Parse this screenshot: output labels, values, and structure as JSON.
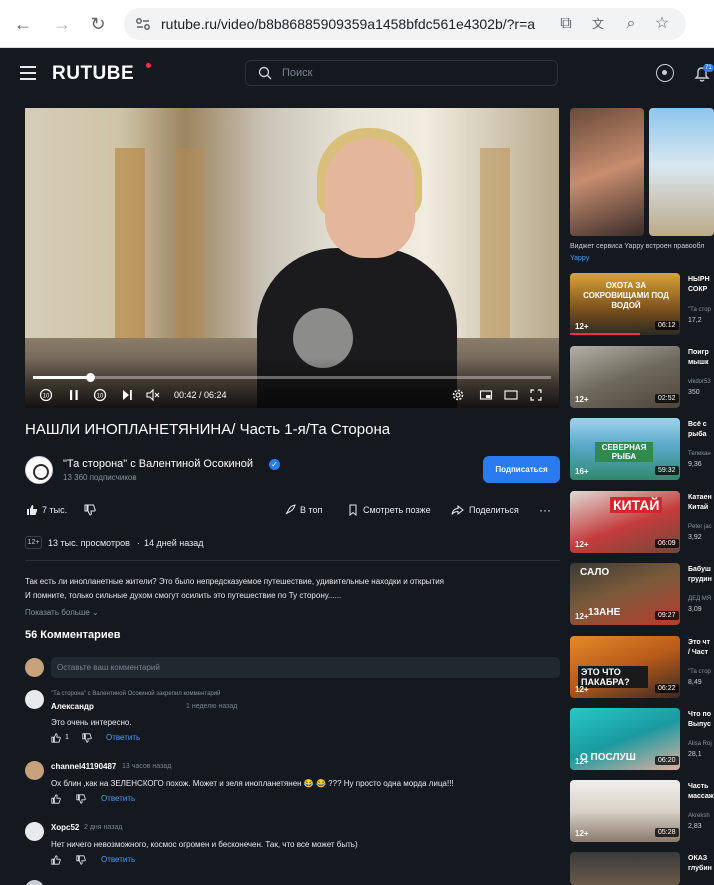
{
  "browser": {
    "url": "rutube.ru/video/b8b86885909359a1458bfdc561e4302b/?r=a"
  },
  "header": {
    "logo": "RUTUBE",
    "search_placeholder": "Поиск",
    "notifications_count": "71"
  },
  "player": {
    "time": "00:42 / 06:24",
    "progress": 0.11,
    "rewind_label": "10",
    "forward_label": "10"
  },
  "video": {
    "title": "НАШЛИ ИНОПЛАНЕТЯНИНА/ Часть 1-я/Та Сторона",
    "channel_name": "\"Та сторона\" с Валентиной Осокиной",
    "subscribers": "13 360 подписчиков",
    "subscribe_label": "Подписаться",
    "likes": "7 тыс.",
    "top_label": "В топ",
    "watch_later_label": "Смотреть позже",
    "share_label": "Поделиться",
    "age": "12+",
    "views": "13 тыс. просмотров",
    "separator": "·",
    "date": "14 дней назад",
    "description_line1": "Так есть ли инопланетные жители? Это было непредсказуемое путешествие, удивительные находки и открытия",
    "description_line2": "И помните, только сильные духом смогут осилить это путешествие по Ту сторону......",
    "show_more": "Показать больше ⌄"
  },
  "comments": {
    "count_label": "56 Комментариев",
    "input_placeholder": "Оставьте ваш комментарий",
    "items": [
      {
        "pinned": "\"Та сторона\" с Валентиной Осокиной закрепил комментарий",
        "author": "Александр",
        "time": "1 неделю назад",
        "text": "Это очень интересно.",
        "likes": "1",
        "reply": "Ответить"
      },
      {
        "author": "channel41190487",
        "time": "13 часов назад",
        "text": "Ох блин ,как на ЗЕЛЕНСКОГО похож. Может и зеля инопланетянен 😂 😂 ???  Ну просто одна морда лица!!!",
        "reply": "Ответить"
      },
      {
        "author": "Хорс52",
        "time": "2 дня назад",
        "text": "Нет ничего невозможного, космос огромен и бесконечен. Так, что все может быть)",
        "reply": "Ответить"
      }
    ]
  },
  "sidebar": {
    "ad": {
      "text": "Виджет сервиса Yappy встроен правообл",
      "brand": "Yappy"
    },
    "items": [
      {
        "age": "12+",
        "duration": "06:12",
        "title1": "НЫРН",
        "title2": "СОКР",
        "channel": "\"Та стор",
        "views": "17,2"
      },
      {
        "age": "12+",
        "duration": "02:52",
        "title1": "Поигр",
        "title2": "мышк",
        "channel": "vikdor53",
        "views": "350"
      },
      {
        "age": "16+",
        "duration": "59:32",
        "title1": "Всё с",
        "title2": "рыба",
        "channel": "Телекан",
        "views": "9,36"
      },
      {
        "age": "12+",
        "duration": "06:09",
        "title1": "Катаен",
        "title2": "Китай",
        "channel": "Peter jac",
        "views": "3,92"
      },
      {
        "age": "12+",
        "duration": "09:27",
        "title1": "Бабуш",
        "title2": "грудин",
        "channel": "ДЕД МЯ",
        "views": "3,09"
      },
      {
        "age": "12+",
        "duration": "06:22",
        "title1": "Это чт",
        "title2": "/ Част",
        "channel": "\"Та стор",
        "views": "8,49"
      },
      {
        "age": "12+",
        "duration": "06:20",
        "title1": "Что по",
        "title2": "Выпус",
        "channel": "Alisa Roj",
        "views": "28,1"
      },
      {
        "age": "12+",
        "duration": "05:28",
        "title1": "Часть",
        "title2": "массаж",
        "channel": "Akreksh",
        "views": "2,83"
      },
      {
        "title1": "ОКАЗ",
        "title2": "глубин"
      }
    ],
    "thumb_texts": [
      "ОХОТА ЗА СОКРОВИЩАМИ ПОД ВОДОЙ",
      "СЕВЕРНАЯ РЫБА",
      "КИТАЙ",
      "САЛО",
      "13АНЕ",
      "ЭТО ЧТО ПАКАБРА?",
      "О ПОСЛУШ"
    ]
  },
  "colors": {
    "accent": "#2b7bf0",
    "brand": "#ff2b4e",
    "background": "#14191f"
  }
}
